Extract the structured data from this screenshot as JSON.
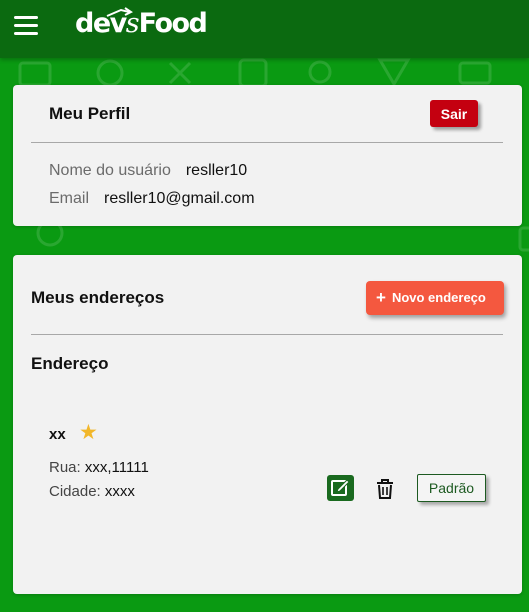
{
  "header": {
    "logo_text_a": "dev",
    "logo_text_b": "s",
    "logo_text_c": "Food",
    "menu_icon": "hamburger-menu-icon",
    "background_color": "#0b6a10"
  },
  "page": {
    "background_color": "#0a9a12"
  },
  "profile": {
    "title": "Meu Perfil",
    "logout_label": "Sair",
    "username_label": "Nome do usuário",
    "username_value": "resller10",
    "email_label": "Email",
    "email_value": "resller10@gmail.com"
  },
  "addresses": {
    "title": "Meus endereços",
    "new_button_label": "Novo endereço",
    "new_button_icon": "plus-icon",
    "section_title": "Endereço",
    "items": [
      {
        "name": "xx",
        "is_favorite_icon": "star-icon",
        "street_label": "Rua:",
        "street_value": "xxx,11111",
        "city_label": "Cidade:",
        "city_value": "xxxx",
        "edit_icon": "edit-icon",
        "delete_icon": "trash-icon",
        "default_button_label": "Padrão"
      }
    ]
  },
  "colors": {
    "accent_red": "#c40010",
    "accent_orange": "#f4583f",
    "dark_green": "#1a6a1f",
    "star_yellow": "#f2b72a"
  }
}
